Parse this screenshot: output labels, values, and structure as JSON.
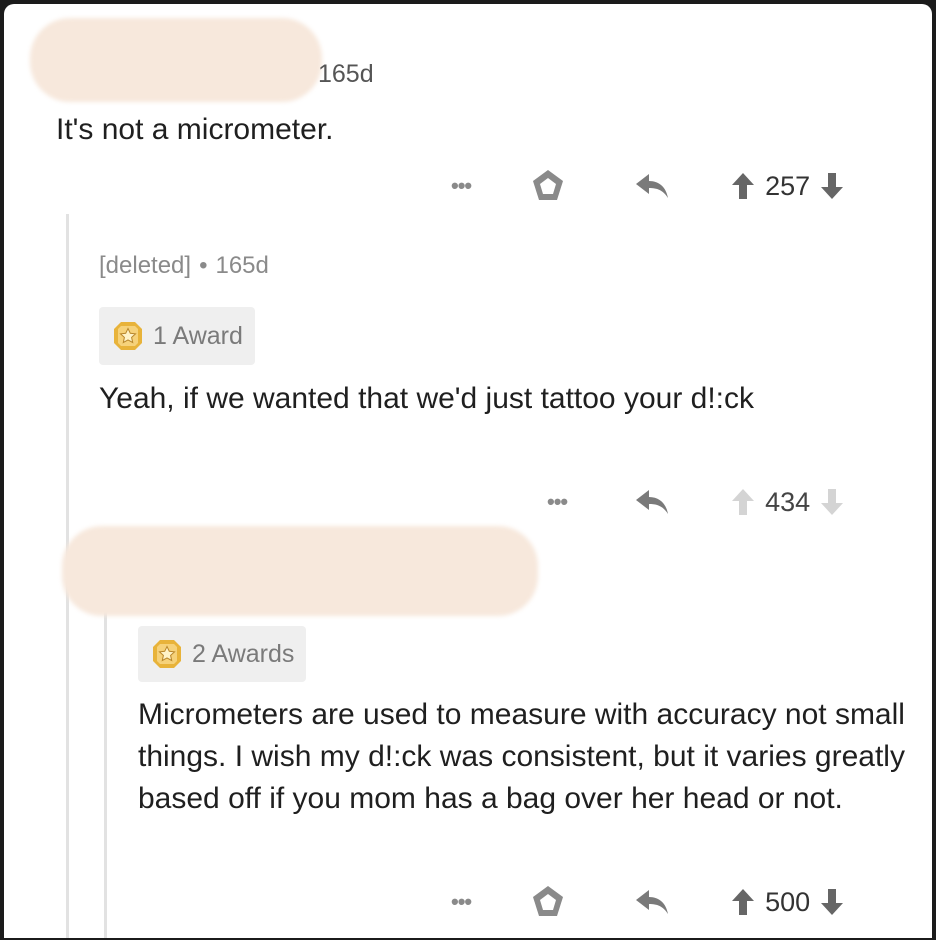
{
  "comments": [
    {
      "meta_suffix": "165d",
      "body": "It's not a micrometer.",
      "actions": {
        "more": "•••",
        "votes": "257"
      }
    },
    {
      "author": "[deleted]",
      "separator": "•",
      "age": "165d",
      "award": "1 Award",
      "body": "Yeah, if we wanted that we'd just tattoo your d!:ck",
      "actions": {
        "more": "•••",
        "votes": "434"
      }
    },
    {
      "award": "2 Awards",
      "body": "Micrometers are used to measure with accuracy not small things. I wish my d!:ck was consistent, but it varies greatly based off if you mom has a bag over her head or not.",
      "actions": {
        "more": "•••",
        "votes": "500"
      }
    }
  ],
  "icons": {
    "award": "award-badge-icon",
    "gild": "gild-icon",
    "reply": "reply-icon",
    "upvote": "upvote-arrow-icon",
    "downvote": "downvote-arrow-icon"
  },
  "colors": {
    "background": "#ffffff",
    "text": "#1f1f1f",
    "meta": "#8a8a8a",
    "award_bg": "#efefef",
    "award_gold": "#e8b33a",
    "redaction": "#f7e8dc"
  }
}
